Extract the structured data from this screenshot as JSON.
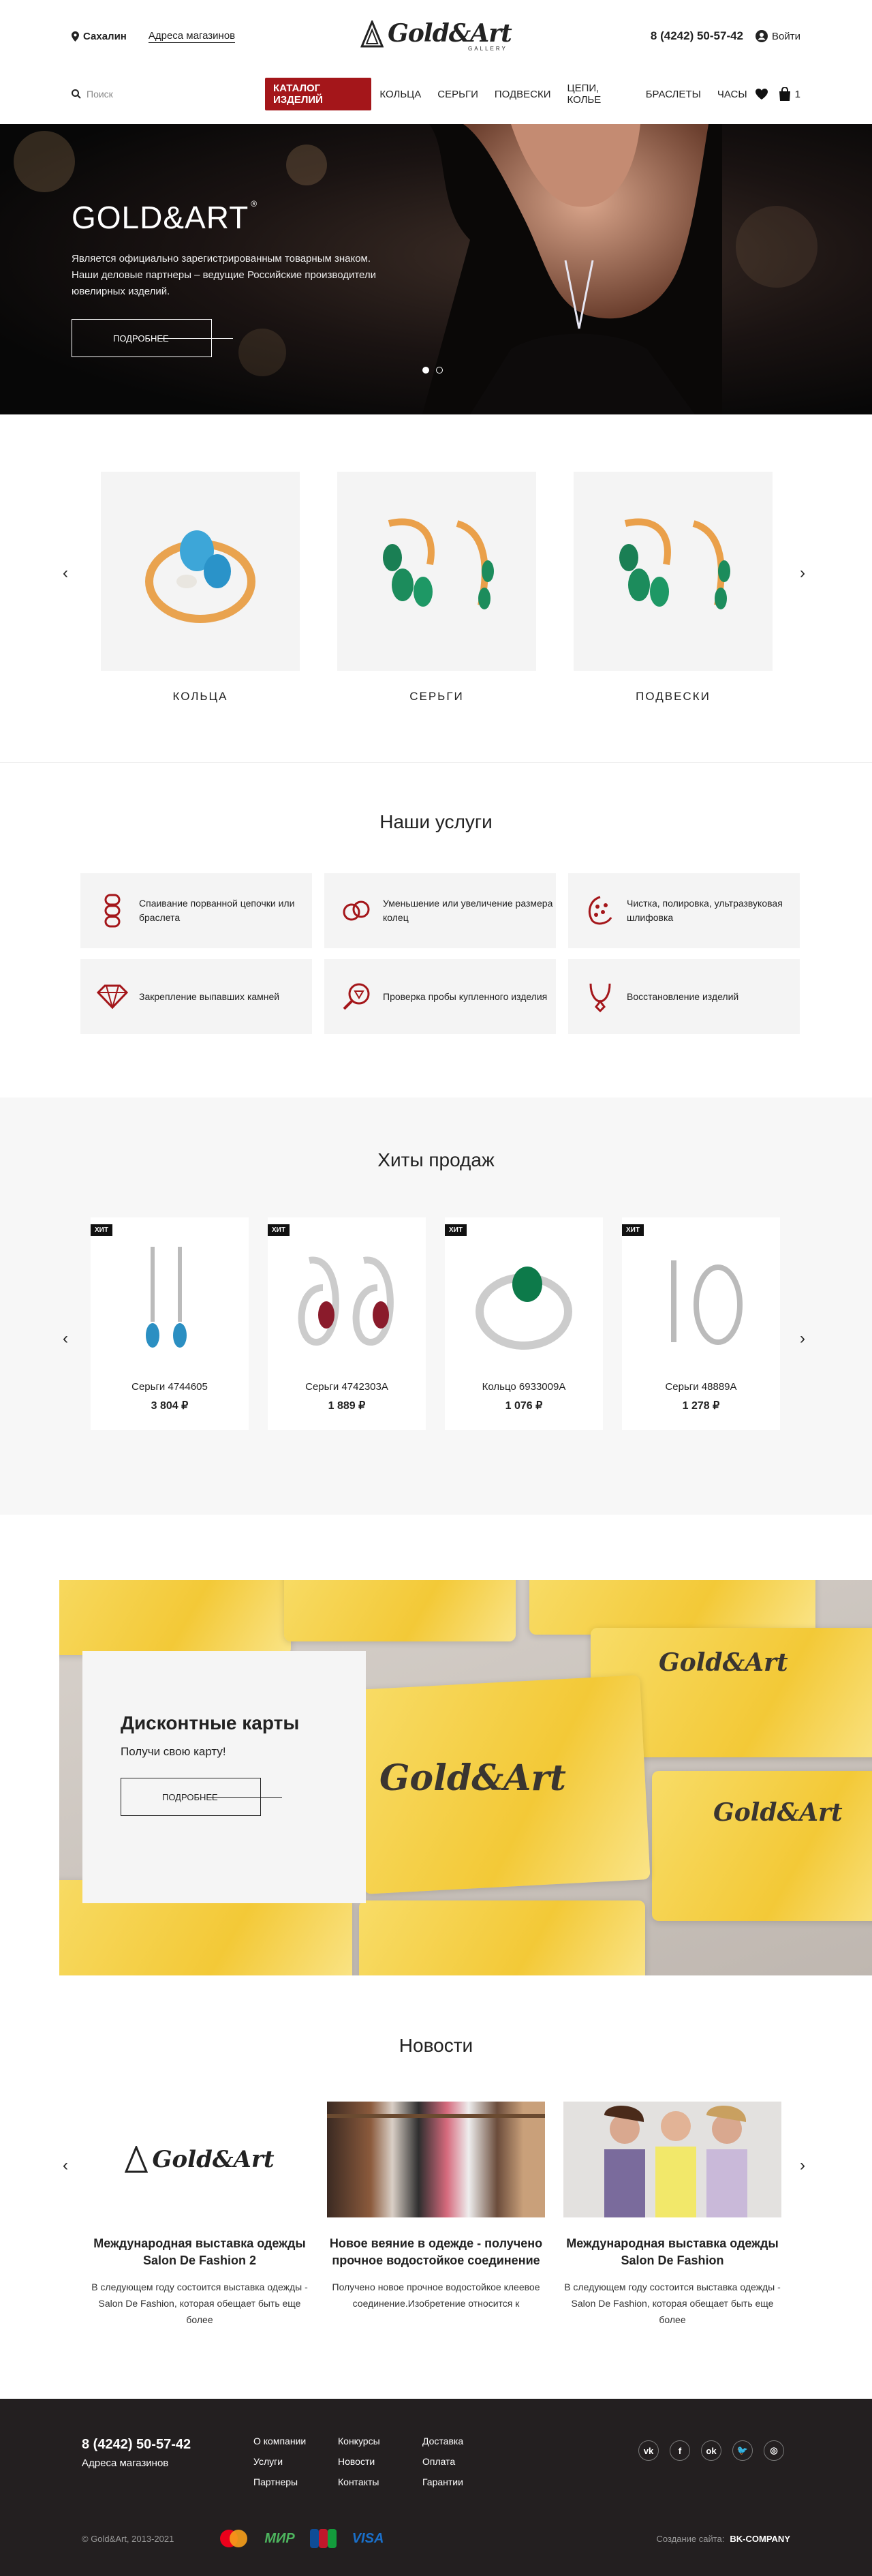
{
  "header": {
    "city": "Сахалин",
    "shops_link": "Адреса магазинов",
    "logo_text": "Gold&Art",
    "logo_sub": "GALLERY",
    "phone": "8 (4242) 50-57-42",
    "login": "Войти",
    "search_placeholder": "Поиск",
    "menu": [
      "КАТАЛОГ ИЗДЕЛИЙ",
      "КОЛЬЦА",
      "СЕРЬГИ",
      "ПОДВЕСКИ",
      "ЦЕПИ, КОЛЬЕ",
      "БРАСЛЕТЫ",
      "ЧАСЫ"
    ],
    "cart_count": "1"
  },
  "hero": {
    "title": "GOLD&ART",
    "title_mark": "®",
    "text": "Является официально зарегистрированным товарным знаком. Наши деловые партнеры – ведущие Российские производители ювелирных изделий.",
    "button": "ПОДРОБНЕЕ"
  },
  "categories": [
    "КОЛЬЦА",
    "СЕРЬГИ",
    "ПОДВЕСКИ"
  ],
  "services": {
    "title": "Наши услуги",
    "items": [
      {
        "text": "Спаивание порванной цепочки или браслета",
        "icon": "chain-icon"
      },
      {
        "text": "Уменьшение или увеличение размера колец",
        "icon": "rings-icon"
      },
      {
        "text": "Чистка, полировка, ультразвуковая шлифовка",
        "icon": "polish-icon"
      },
      {
        "text": "Закрепление выпавших камней",
        "icon": "diamond-icon"
      },
      {
        "text": "Проверка пробы купленного изделия",
        "icon": "magnifier-icon"
      },
      {
        "text": "Восстановление изделий",
        "icon": "necklace-icon"
      }
    ]
  },
  "hits": {
    "title": "Хиты продаж",
    "tag": "ХИТ",
    "items": [
      {
        "name": "Серьги 4744605",
        "price": "3 804 ₽"
      },
      {
        "name": "Серьги 4742303А",
        "price": "1 889 ₽"
      },
      {
        "name": "Кольцо 6933009А",
        "price": "1 076 ₽"
      },
      {
        "name": "Серьги 48889А",
        "price": "1 278 ₽"
      }
    ]
  },
  "discount": {
    "title": "Дисконтные карты",
    "subtitle": "Получи свою карту!",
    "button": "ПОДРОБНЕЕ",
    "card_logo": "Gold&Art"
  },
  "news": {
    "title": "Новости",
    "items": [
      {
        "title": "Международная выставка одежды Salon De Fashion 2",
        "text": "В следующем году состоится выставка одежды - Salon De Fashion, которая обещает быть еще более"
      },
      {
        "title": "Новое веяние в одежде - получено прочное водостойкое соединение",
        "text": "Получено новое прочное водостойкое клеевое соединение.Изобретение относится к"
      },
      {
        "title": "Международная выставка одежды Salon De Fashion",
        "text": "В следующем году состоится выставка одежды - Salon De Fashion, которая обещает быть еще более"
      }
    ]
  },
  "footer": {
    "phone": "8 (4242) 50-57-42",
    "shops": "Адреса магазинов",
    "links": [
      "О компании",
      "Конкурсы",
      "Доставка",
      "Услуги",
      "Новости",
      "Оплата",
      "Партнеры",
      "Контакты",
      "Гарантии"
    ],
    "social": [
      "vk",
      "f",
      "ok",
      "tw",
      "ig"
    ],
    "copyright": "© Gold&Art, 2013-2021",
    "pay_mir": "МИР",
    "pay_visa": "VISA",
    "made_label": "Создание сайта:",
    "made_by": "BK-COMPANY"
  }
}
